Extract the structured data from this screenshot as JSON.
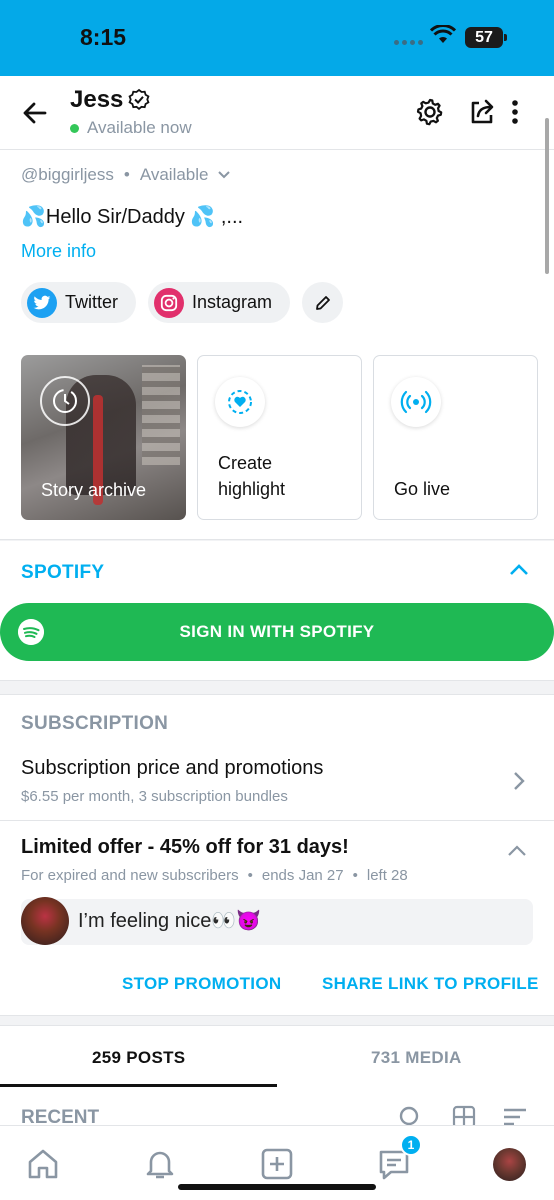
{
  "status_bar": {
    "time": "8:15",
    "battery": "57"
  },
  "header": {
    "name": "Jess",
    "status": "Available now"
  },
  "profile": {
    "handle": "@biggirljess",
    "separator": "•",
    "availability": "Available",
    "bio": "💦Hello Sir/Daddy 💦 ,...",
    "more_info": "More info",
    "socials": [
      {
        "label": "Twitter",
        "icon": "twitter-icon",
        "color": "#1da1f2"
      },
      {
        "label": "Instagram",
        "icon": "instagram-icon",
        "color": "#e1306c"
      }
    ],
    "cards": [
      {
        "label": "Story archive",
        "icon": "clock-history-icon"
      },
      {
        "label": "Create highlight",
        "icon": "heart-circle-icon"
      },
      {
        "label": "Go live",
        "icon": "broadcast-icon"
      }
    ]
  },
  "spotify": {
    "title": "SPOTIFY",
    "button": "SIGN IN WITH SPOTIFY"
  },
  "subscription": {
    "title": "SUBSCRIPTION",
    "row_title": "Subscription price and promotions",
    "row_sub": "$6.55 per month, 3 subscription bundles",
    "offer_title": "Limited offer - 45% off for 31 days!",
    "offer_meta": [
      "For expired and new subscribers",
      "•",
      "ends Jan 27",
      "•",
      "left 28"
    ],
    "message": "I’m feeling nice👀😈",
    "stop_promotion": "STOP PROMOTION",
    "share_link": "SHARE LINK TO PROFILE"
  },
  "tabs": [
    {
      "label": "259 POSTS",
      "active": true
    },
    {
      "label": "731 MEDIA",
      "active": false
    }
  ],
  "recent_label": "RECENT",
  "nav": {
    "messages_badge": "1"
  },
  "colors": {
    "accent": "#00aff0",
    "spotify_green": "#1fb954",
    "status_bar": "#04a9e8"
  }
}
